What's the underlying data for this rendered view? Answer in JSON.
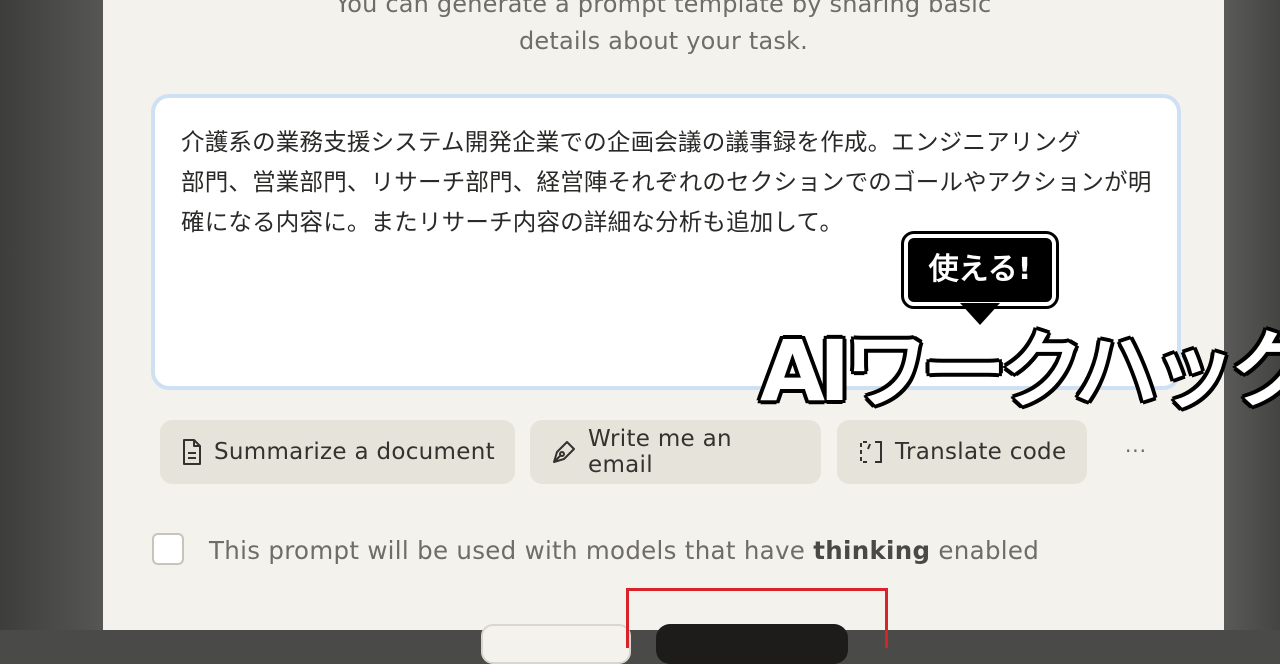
{
  "subtitle": {
    "line1": "You can generate a prompt template by sharing basic",
    "line2": "details about your task."
  },
  "prompt_input": {
    "value": "介護系の業務支援システム開発企業での企画会議の議事録を作成。エンジニアリング\n部門、営業部門、リサーチ部門、経営陣それぞれのセクションでのゴールやアクションが明\n確になる内容に。またリサーチ内容の詳細な分析も追加して。"
  },
  "suggestions": [
    {
      "label": "Summarize a document",
      "icon": "document-icon"
    },
    {
      "label": "Write me an email",
      "icon": "pen-icon"
    },
    {
      "label": "Translate code",
      "icon": "code-bracket-icon"
    }
  ],
  "more_label": "···",
  "thinking_option": {
    "checked": false,
    "label_before": "This prompt will be used with models that have ",
    "label_bold": "thinking",
    "label_after": " enabled"
  },
  "watermark": {
    "bubble": "使える!",
    "logo": "AIワークハック"
  },
  "colors": {
    "panel_bg": "#f4f2ec",
    "chip_bg": "#e6e3da",
    "input_border": "#cfe0f2",
    "highlight_frame": "#d8232a",
    "primary_button": "#1d1c1a"
  }
}
